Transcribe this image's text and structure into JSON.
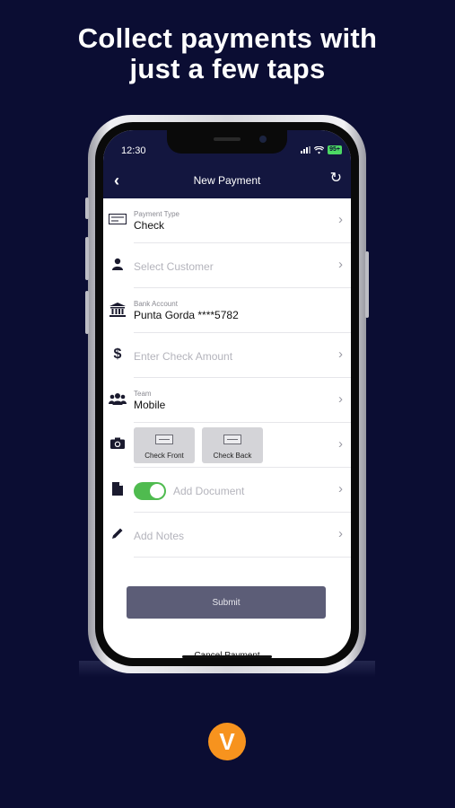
{
  "headline": {
    "line1": "Collect payments with",
    "line2": "just a few taps"
  },
  "status_bar": {
    "time": "12:30",
    "battery": "95+"
  },
  "nav": {
    "back_icon": "‹",
    "title": "New Payment",
    "refresh_icon": "↻"
  },
  "form": {
    "payment_type": {
      "label": "Payment Type",
      "value": "Check",
      "icon": "check-icon"
    },
    "customer": {
      "placeholder": "Select Customer",
      "icon": "person-icon"
    },
    "bank_account": {
      "label": "Bank Account",
      "value": "Punta Gorda ****5782",
      "icon": "bank-icon"
    },
    "amount": {
      "placeholder": "Enter Check Amount",
      "icon": "dollar-icon"
    },
    "team": {
      "label": "Team",
      "value": "Mobile",
      "icon": "team-icon"
    },
    "photos": {
      "front_label": "Check Front",
      "back_label": "Check Back",
      "icon": "camera-icon"
    },
    "document": {
      "placeholder": "Add Document",
      "toggle_on": true,
      "icon": "document-icon"
    },
    "notes": {
      "placeholder": "Add Notes",
      "icon": "pencil-icon"
    }
  },
  "actions": {
    "submit": "Submit",
    "cancel": "Cancel Payment"
  },
  "logo": {
    "letter": "V",
    "color": "#f7931e"
  },
  "colors": {
    "background": "#0b0d33",
    "header": "#13163f",
    "toggle": "#4fbb4f",
    "submit": "#5c5d77"
  }
}
